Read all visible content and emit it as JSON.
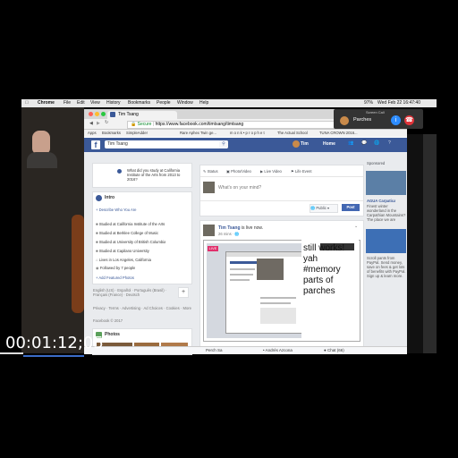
{
  "menubar": {
    "apple": "",
    "app": "Chrome",
    "items": [
      "File",
      "Edit",
      "View",
      "History",
      "Bookmarks",
      "People",
      "Window",
      "Help"
    ],
    "battery": "97%",
    "clock": "Wed Feb 22  16:47:40"
  },
  "call": {
    "status": "Screen Call",
    "name": "Parches"
  },
  "browser": {
    "tab_title": "Tim Tsang",
    "url_secure": "Secure",
    "url": "https://www.facebook.com/timtsang/timtsang",
    "bookmarks": [
      "Apps",
      "Bookmarks",
      "SimpleAdder",
      "Rare Aphex Twin ge...",
      "m o n k • p r o p h e t",
      "The Actual School",
      "TUNA CROWN 2016..."
    ]
  },
  "fb": {
    "search_value": "Tim Tsang",
    "nav": {
      "user": "Tim",
      "home": "Home"
    },
    "question": "What did you study at California Institute of the Arts from 2013 to 2016?",
    "intro": {
      "title": "Intro",
      "describe": "Describe Who You Are",
      "items": [
        "Studied at California Institute of the Arts",
        "Studied at Berklee College of Music",
        "Studied at University of British Columbia",
        "Studied at Capilano University",
        "Lives in Los Angeles, California",
        "Followed by 7 people"
      ],
      "add_featured": "Add Featured Photos"
    },
    "footer": {
      "langs": "English (US) · Español · Português (Brasil) · Français (France) · Deutsch",
      "links": "Privacy · Terms · Advertising · Ad Choices · Cookies · More",
      "copyright": "Facebook © 2017"
    },
    "photos": "Photos",
    "composer": {
      "tabs": [
        "Status",
        "Photo/Video",
        "Live Video",
        "Life Event"
      ],
      "placeholder": "What's on your mind?",
      "privacy": "Public",
      "post": "Post"
    },
    "post": {
      "author": "Tim Tsang",
      "action": "is live now.",
      "time": "26 mins ·",
      "live_badge": "LIVE",
      "overlay_text": "still works!\nyah\n#memory\nparts of\nparches"
    },
    "sponsored": {
      "label": "Sponsored",
      "ad1_title": "AGUA Carpatica",
      "ad1_text": "Finest winter wonderland in the Carpathian Mountains? The place we are loved.",
      "ad2_text": "Scroll pants from PayPal. Send money, save on fees & get lots of benefits with PayPal. Sign up & learn more."
    },
    "chat": {
      "left": "Perch Sa",
      "mid": "Andrés Azcona",
      "chat": "Chat (66)"
    }
  },
  "timecode": "00:01:12;05",
  "colors": {
    "fb_blue": "#3b5998",
    "call_info": "#2d8cff",
    "call_end": "#e0343a"
  }
}
